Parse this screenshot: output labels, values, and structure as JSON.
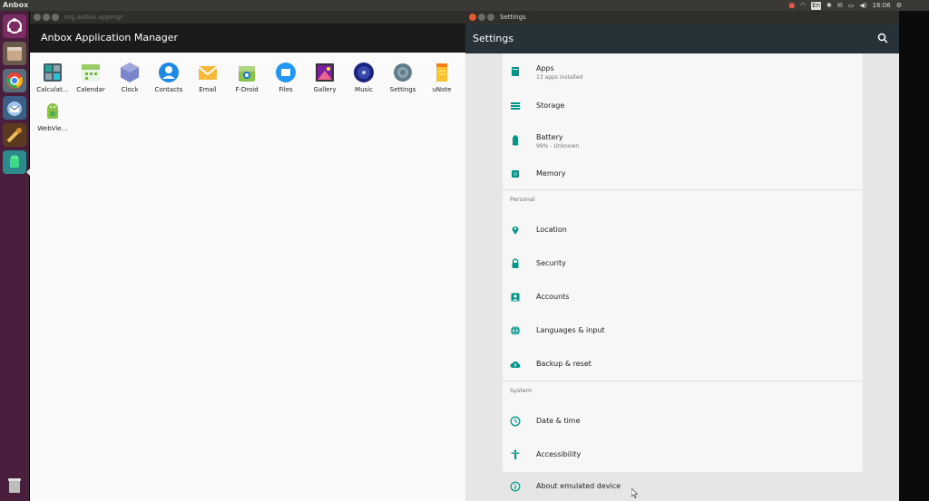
{
  "top_panel": {
    "title": "Anbox",
    "tray": {
      "keyboard": "En",
      "clock": "16:06"
    }
  },
  "launcher": {
    "items": [
      {
        "name": "ubuntu-dash",
        "color": "#7b2d63"
      },
      {
        "name": "files",
        "color": "#c7a98a"
      },
      {
        "name": "chromium",
        "color": "#4a7fc0"
      },
      {
        "name": "thunderbird",
        "color": "#2f6fb0"
      },
      {
        "name": "system-tools",
        "color": "#8a5b2a"
      },
      {
        "name": "anbox",
        "color": "#3ebf6a"
      },
      {
        "name": "trash",
        "color": "#9a9a9a"
      }
    ]
  },
  "appmgr": {
    "window_title": "org.anbox.appmgr",
    "toolbar_title": "Anbox Application Manager",
    "apps": [
      {
        "label": "Calculat…",
        "icon": "calculator-icon",
        "color": "#455a64"
      },
      {
        "label": "Calendar",
        "icon": "calendar-icon",
        "color": "#9ccc65"
      },
      {
        "label": "Clock",
        "icon": "clock-icon",
        "color": "#7986cb"
      },
      {
        "label": "Contacts",
        "icon": "contacts-icon",
        "color": "#1e88e5"
      },
      {
        "label": "Email",
        "icon": "email-icon",
        "color": "#f6b93b"
      },
      {
        "label": "F-Droid",
        "icon": "fdroid-icon",
        "color": "#8bc34a"
      },
      {
        "label": "Files",
        "icon": "files-icon",
        "color": "#2196f3"
      },
      {
        "label": "Gallery",
        "icon": "gallery-icon",
        "color": "#7b1fa2"
      },
      {
        "label": "Music",
        "icon": "music-icon",
        "color": "#1a237e"
      },
      {
        "label": "Settings",
        "icon": "settings-icon",
        "color": "#607d8b"
      },
      {
        "label": "uNote",
        "icon": "unote-icon",
        "color": "#fbc02d"
      },
      {
        "label": "WebVie…",
        "icon": "webview-icon",
        "color": "#8bc34a"
      }
    ]
  },
  "settings": {
    "window_title": "Settings",
    "toolbar_title": "Settings",
    "accent": "#009688",
    "items": [
      {
        "key": "apps",
        "title": "Apps",
        "subtitle": "13 apps installed",
        "icon": "apps-icon"
      },
      {
        "key": "storage",
        "title": "Storage",
        "subtitle": "",
        "icon": "storage-icon"
      },
      {
        "key": "battery",
        "title": "Battery",
        "subtitle": "99% - Unknown",
        "icon": "battery-icon"
      },
      {
        "key": "memory",
        "title": "Memory",
        "subtitle": "",
        "icon": "memory-icon"
      },
      {
        "key": "location",
        "title": "Location",
        "subtitle": "",
        "icon": "location-icon"
      },
      {
        "key": "security",
        "title": "Security",
        "subtitle": "",
        "icon": "lock-icon"
      },
      {
        "key": "accounts",
        "title": "Accounts",
        "subtitle": "",
        "icon": "account-icon"
      },
      {
        "key": "languages",
        "title": "Languages & input",
        "subtitle": "",
        "icon": "globe-icon"
      },
      {
        "key": "backup",
        "title": "Backup & reset",
        "subtitle": "",
        "icon": "cloud-upload-icon"
      },
      {
        "key": "datetime",
        "title": "Date & time",
        "subtitle": "",
        "icon": "clock-icon"
      },
      {
        "key": "accessibility",
        "title": "Accessibility",
        "subtitle": "",
        "icon": "accessibility-icon"
      },
      {
        "key": "about",
        "title": "About emulated device",
        "subtitle": "",
        "icon": "info-icon"
      }
    ],
    "sections": {
      "personal": "Personal",
      "system": "System"
    }
  }
}
